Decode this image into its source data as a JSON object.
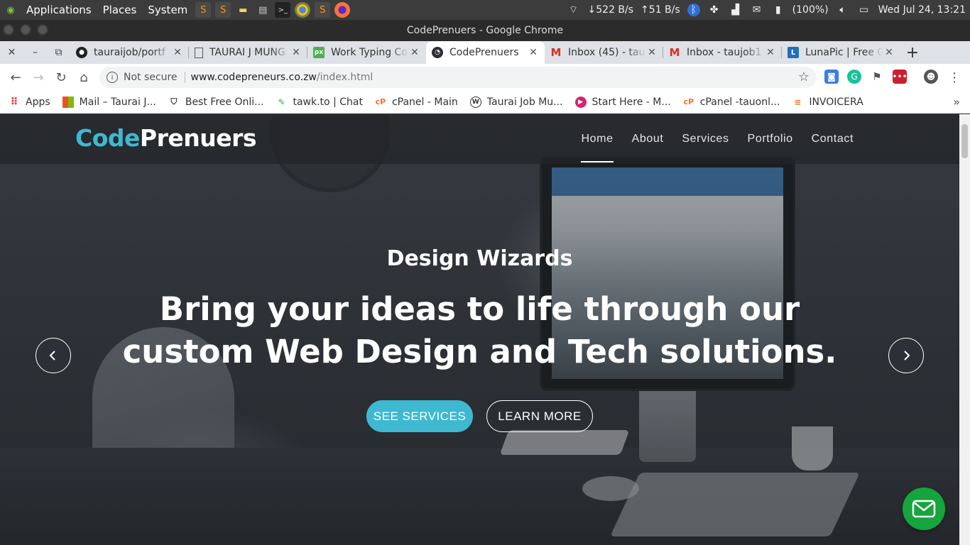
{
  "system_panel": {
    "menu": [
      "Applications",
      "Places",
      "System"
    ],
    "net_down": "522 B/s",
    "net_up": "51 B/s",
    "battery": "(100%)",
    "datetime": "Wed Jul 24, 13:21"
  },
  "window": {
    "title": "CodePrenuers - Google Chrome"
  },
  "tabs": [
    {
      "label": "tauraijob/portf",
      "icon": "github-icon"
    },
    {
      "label": "TAURAI J MUNG",
      "icon": "document-icon"
    },
    {
      "label": "Work Typing Co",
      "icon": "px-icon"
    },
    {
      "label": "CodePrenuers",
      "icon": "site-icon",
      "active": true
    },
    {
      "label": "Inbox (45) - tau",
      "icon": "gmail-icon"
    },
    {
      "label": "Inbox - taujob1",
      "icon": "gmail-icon"
    },
    {
      "label": "LunaPic | Free O",
      "icon": "lunapic-icon"
    }
  ],
  "address_bar": {
    "security": "Not secure",
    "host": "www.codepreneurs.co.zw",
    "path": "/index.html"
  },
  "bookmarks": [
    {
      "label": "Apps"
    },
    {
      "label": "Mail – Taurai J..."
    },
    {
      "label": "Best Free Onli..."
    },
    {
      "label": "tawk.to | Chat"
    },
    {
      "label": "cPanel - Main"
    },
    {
      "label": "Taurai Job Mu..."
    },
    {
      "label": "Start Here - M..."
    },
    {
      "label": "cPanel -tauonl..."
    },
    {
      "label": "INVOICERA"
    }
  ],
  "site": {
    "logo_part1": "Code",
    "logo_part2": "Prenuers",
    "nav": [
      "Home",
      "About",
      "Services",
      "Portfolio",
      "Contact"
    ],
    "active_nav": "Home",
    "brand_color": "#3fb8d1",
    "hero": {
      "subtitle": "Design Wizards",
      "title_line1": "Bring your ideas to life through our",
      "title_line2": "custom Web Design and Tech solutions.",
      "primary_button": "SEE SERVICES",
      "secondary_button": "LEARN MORE"
    },
    "chat_color": "#15a53c"
  }
}
